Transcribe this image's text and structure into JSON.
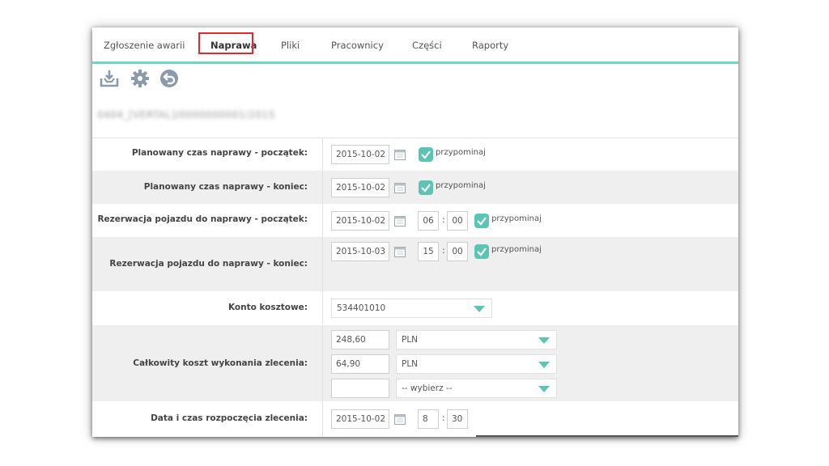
{
  "tabs": [
    {
      "label": "Zgłoszenie awarii"
    },
    {
      "label": "Naprawa"
    },
    {
      "label": "Pliki"
    },
    {
      "label": "Pracownicy"
    },
    {
      "label": "Części"
    },
    {
      "label": "Raporty"
    }
  ],
  "active_tab": "Naprawa",
  "toolbar": {
    "icons": [
      "save-tray-icon",
      "gear-icon",
      "undo-icon"
    ]
  },
  "record_id": "0404_[VERTAL]/0000000001/2015",
  "colors": {
    "accent": "#6fd3c6",
    "checkbox": "#5cc4b5",
    "highlight": "#e8262c",
    "row_alt": "#efefef"
  },
  "reminder_label": "przypominaj",
  "form": {
    "planned_start": {
      "label": "Planowany czas naprawy - początek:",
      "date": "2015-10-02",
      "remind": true
    },
    "planned_end": {
      "label": "Planowany czas naprawy - koniec:",
      "date": "2015-10-02",
      "remind": true
    },
    "reservation_start": {
      "label": "Rezerwacja pojazdu do naprawy - początek:",
      "date": "2015-10-02",
      "hour": "06",
      "minute": "00",
      "remind": true
    },
    "reservation_end": {
      "label": "Rezerwacja pojazdu do naprawy - koniec:",
      "date": "2015-10-03",
      "hour": "15",
      "minute": "00",
      "remind": true
    },
    "cost_account": {
      "label": "Konto kosztowe:",
      "value": "534401010"
    },
    "total_cost": {
      "label": "Całkowity koszt wykonania zlecenia:",
      "lines": [
        {
          "amount": "248,60",
          "currency": "PLN"
        },
        {
          "amount": "64,90",
          "currency": "PLN"
        },
        {
          "amount": "",
          "currency": "-- wybierz --"
        }
      ]
    },
    "order_start": {
      "label": "Data i czas rozpoczęcia zlecenia:",
      "date": "2015-10-02",
      "hour": "8",
      "minute": "30"
    }
  }
}
